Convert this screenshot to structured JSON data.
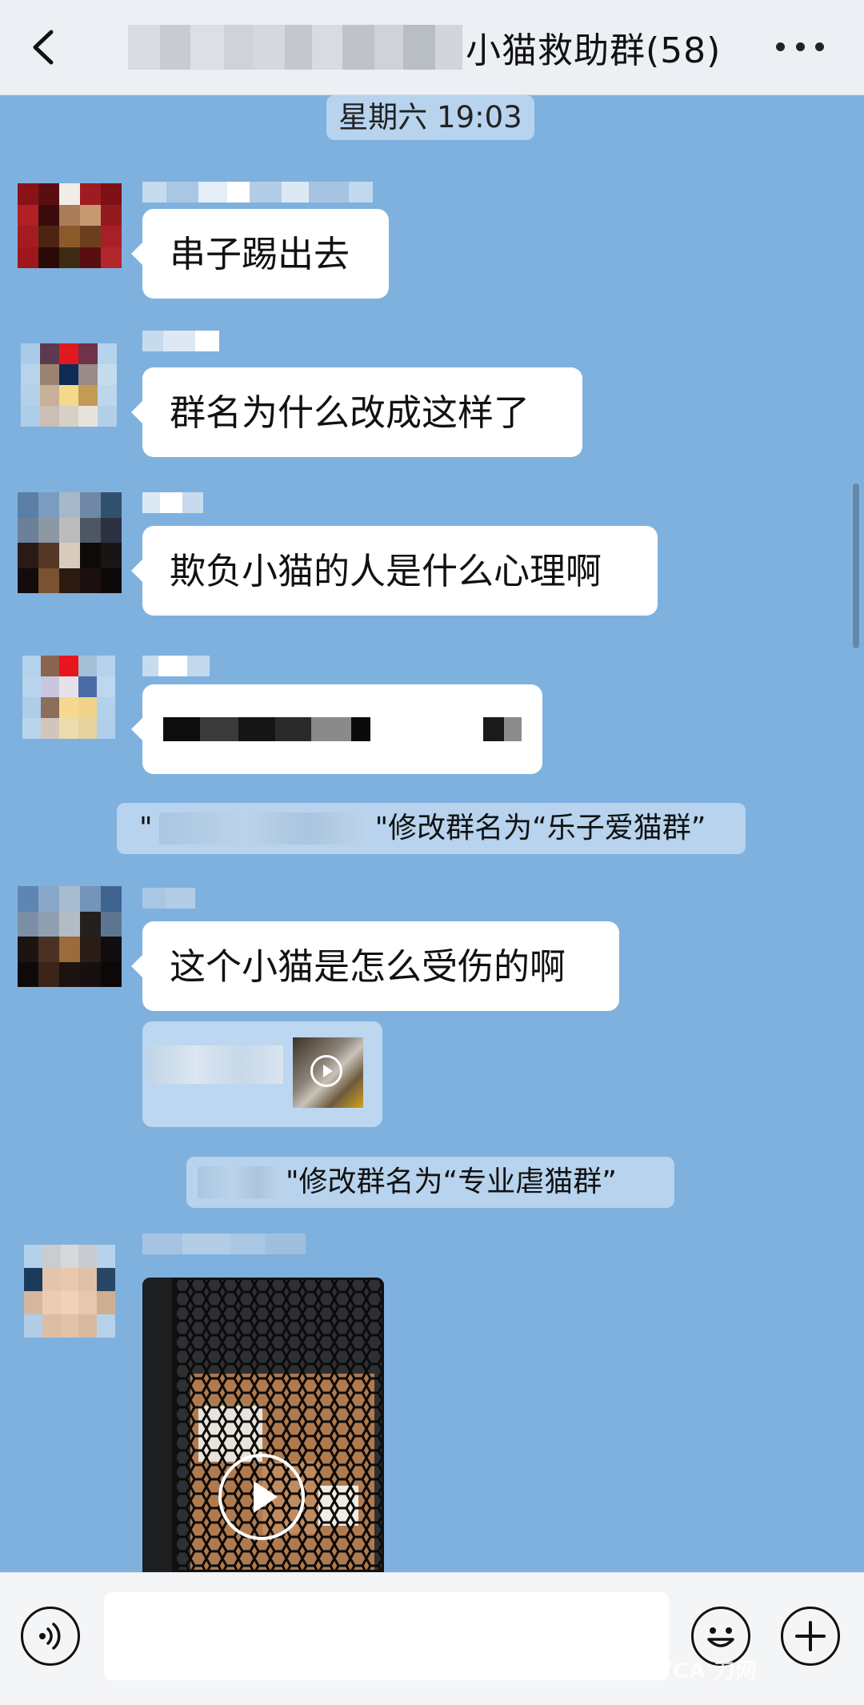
{
  "header": {
    "title": "小猫救助群(58)",
    "back_icon": "chevron-left-icon",
    "more_icon": "more-horizontal-icon"
  },
  "chat": {
    "time_divider": "星期六 19:03",
    "messages": [
      {
        "type": "text",
        "text": "串子踢出去"
      },
      {
        "type": "text",
        "text": "群名为什么改成这样了"
      },
      {
        "type": "text",
        "text": "欺负小猫的人是什么心理啊"
      },
      {
        "type": "redacted_text"
      },
      {
        "type": "system",
        "quote_open": "\"",
        "text": "\"修改群名为“乐子爱猫群”"
      },
      {
        "type": "text",
        "text": "这个小猫是怎么受伤的啊"
      },
      {
        "type": "video_card"
      },
      {
        "type": "system",
        "text": "\"修改群名为“专业虐猫群”"
      },
      {
        "type": "video"
      }
    ]
  },
  "input_bar": {
    "voice_icon": "voice-icon",
    "emoji_icon": "emoji-icon",
    "add_icon": "plus-icon",
    "input_value": "",
    "watermark": "VCA 刀网"
  },
  "colors": {
    "chat_background": "#7fb1df",
    "bubble": "#ffffff",
    "header_background": "#eceff3"
  }
}
